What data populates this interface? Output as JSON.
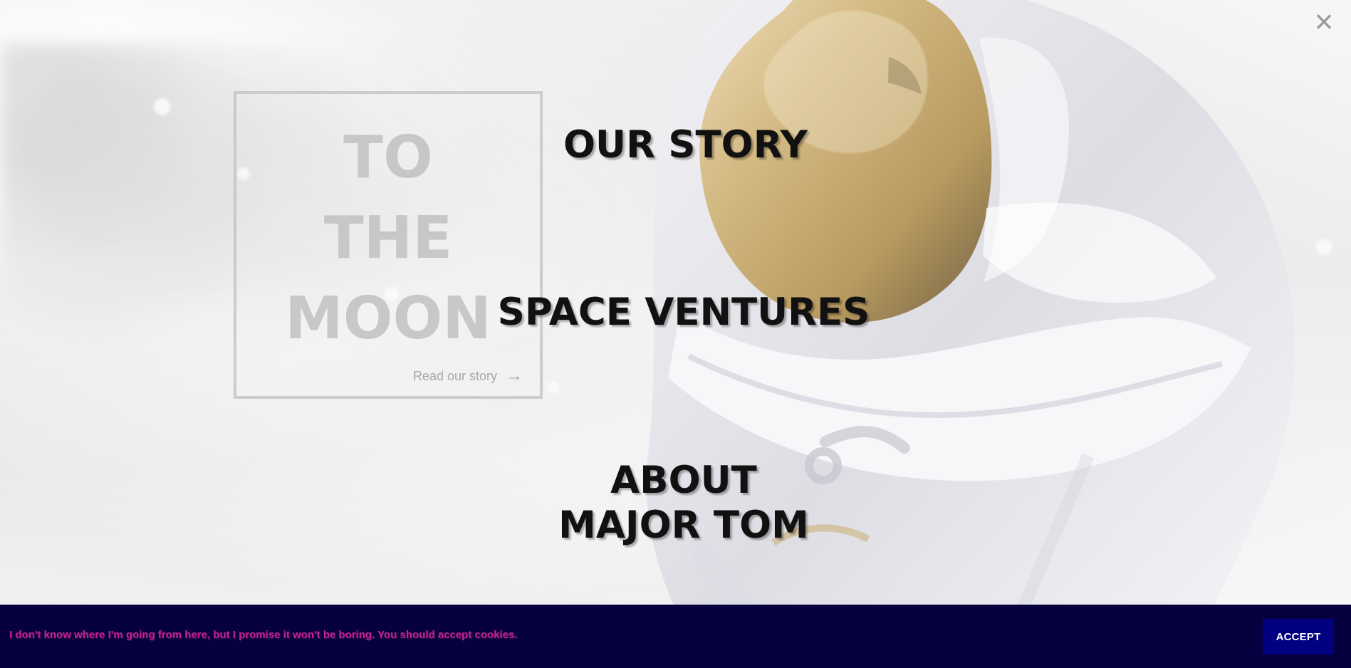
{
  "overlay": {
    "close_label": "×"
  },
  "feature_card": {
    "title_lines": [
      "TO",
      "THE",
      "MOON"
    ],
    "link_label": "Read our story",
    "link_arrow": "→"
  },
  "navigation": {
    "items": [
      {
        "label": "OUR STORY"
      },
      {
        "label": "SPACE VENTURES"
      },
      {
        "label_lines": [
          "ABOUT",
          "MAJOR TOM"
        ]
      }
    ]
  },
  "cookie_banner": {
    "message": "I don't know where I'm going from here, but I promise it won't be boring. You should accept cookies.",
    "accept_label": "ACCEPT"
  },
  "colors": {
    "cookie_background": "#06003f",
    "cookie_text": "#c52291",
    "accept_button": "#000080",
    "menu_text": "#111111",
    "card_text": "#bebebe"
  },
  "icons": {
    "close": "close-icon",
    "read_arrow": "arrow-right-icon"
  }
}
